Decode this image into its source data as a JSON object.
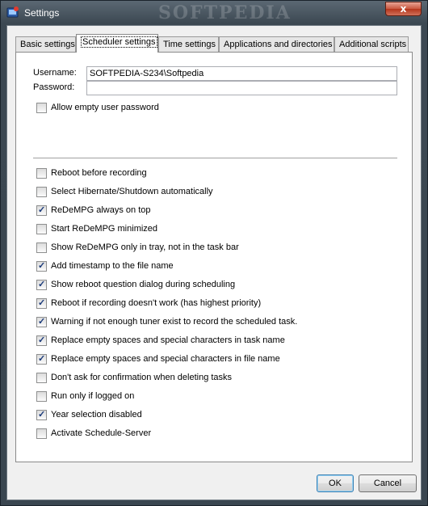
{
  "window": {
    "title": "Settings",
    "watermark": "SOFTPEDIA",
    "close_glyph": "x"
  },
  "tabs": [
    {
      "label": "Basic settings"
    },
    {
      "label": "Scheduler settings",
      "active": true
    },
    {
      "label": "Time settings"
    },
    {
      "label": "Applications and directories"
    },
    {
      "label": "Additional scripts"
    }
  ],
  "form": {
    "username_label": "Username:",
    "username_value": "SOFTPEDIA-S234\\Softpedia",
    "password_label": "Password:",
    "password_value": "",
    "allow_empty": {
      "label": "Allow empty user password",
      "checked": false
    }
  },
  "options": [
    {
      "label": "Reboot before recording",
      "checked": false
    },
    {
      "label": "Select Hibernate/Shutdown automatically",
      "checked": false
    },
    {
      "label": "ReDeMPG always on top",
      "checked": true
    },
    {
      "label": "Start ReDeMPG minimized",
      "checked": false
    },
    {
      "label": "Show ReDeMPG only in tray, not in the task bar",
      "checked": false
    },
    {
      "label": "Add timestamp to the file name",
      "checked": true
    },
    {
      "label": "Show reboot question dialog during scheduling",
      "checked": true
    },
    {
      "label": "Reboot if recording doesn't work (has highest priority)",
      "checked": true
    },
    {
      "label": "Warning if not enough tuner exist to record the scheduled task.",
      "checked": true
    },
    {
      "label": "Replace empty spaces and special characters in task name",
      "checked": true
    },
    {
      "label": "Replace empty spaces and special characters in file name",
      "checked": true
    },
    {
      "label": "Don't ask for confirmation when deleting tasks",
      "checked": false
    },
    {
      "label": "Run only if logged on",
      "checked": false
    },
    {
      "label": "Year selection disabled",
      "checked": true
    },
    {
      "label": "Activate Schedule-Server",
      "checked": false
    }
  ],
  "buttons": {
    "ok": "OK",
    "cancel": "Cancel"
  }
}
